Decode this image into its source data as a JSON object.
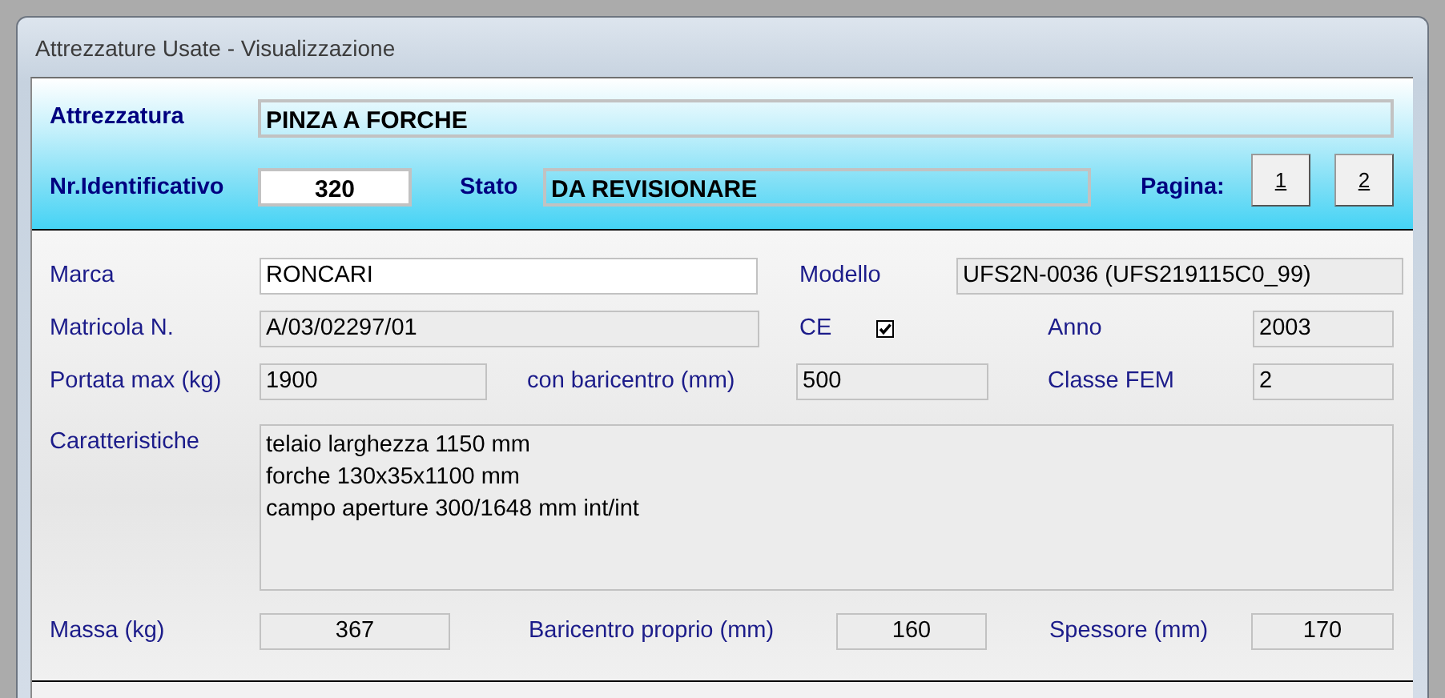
{
  "window": {
    "title": "Attrezzature Usate - Visualizzazione"
  },
  "header": {
    "attrezzatura": {
      "label": "Attrezzatura",
      "value": "PINZA A FORCHE"
    },
    "identificativo": {
      "label": "Nr.Identificativo",
      "value": "320"
    },
    "stato": {
      "label": "Stato",
      "value": "DA REVISIONARE"
    },
    "pagina": {
      "label": "Pagina:",
      "buttons": [
        "1",
        "2"
      ]
    }
  },
  "details": {
    "marca": {
      "label": "Marca",
      "value": "RONCARI"
    },
    "modello": {
      "label": "Modello",
      "value": "UFS2N-0036 (UFS219115C0_99)"
    },
    "matricola": {
      "label": "Matricola N.",
      "value": "A/03/02297/01"
    },
    "ce": {
      "label": "CE",
      "checked": true
    },
    "anno": {
      "label": "Anno",
      "value": "2003"
    },
    "portata": {
      "label": "Portata max (kg)",
      "value": "1900"
    },
    "baricentro": {
      "label": "con baricentro (mm)",
      "value": "500"
    },
    "classe_fem": {
      "label": "Classe FEM",
      "value": "2"
    },
    "caratteristiche": {
      "label": "Caratteristiche",
      "lines": [
        "telaio larghezza 1150 mm",
        "forche 130x35x1100 mm",
        "campo aperture 300/1648 mm int/int"
      ]
    },
    "massa": {
      "label": "Massa (kg)",
      "value": "367"
    },
    "baricentro_proprio": {
      "label": "Baricentro proprio (mm)",
      "value": "160"
    },
    "spessore": {
      "label": "Spessore (mm)",
      "value": "170"
    }
  }
}
